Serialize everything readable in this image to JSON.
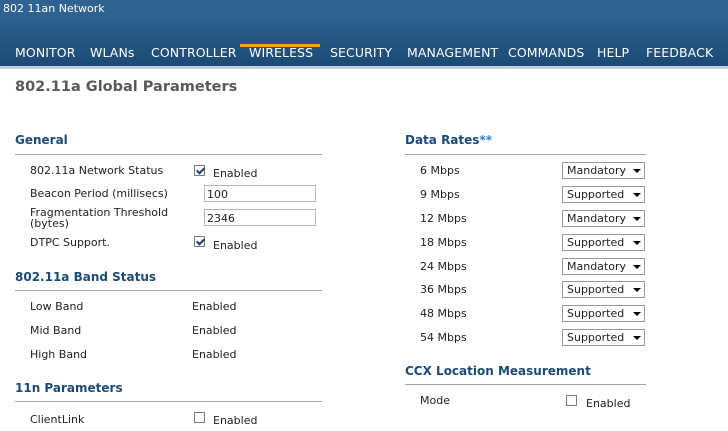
{
  "window_title": "802 11an Network",
  "nav": [
    "MONITOR",
    "WLANs",
    "CONTROLLER",
    "WIRELESS",
    "SECURITY",
    "MANAGEMENT",
    "COMMANDS",
    "HELP",
    "FEEDBACK"
  ],
  "nav_active": "WIRELESS",
  "page_title": "802.11a Global Parameters",
  "general": {
    "title": "General",
    "network_status_label": "802.11a Network Status",
    "network_status_checked": true,
    "network_status_text": "Enabled",
    "beacon_label": "Beacon Period (millisecs)",
    "beacon_value": "100",
    "frag_label": "Fragmentation Threshold (bytes)",
    "frag_value": "2346",
    "dtpc_label": "DTPC Support.",
    "dtpc_checked": true,
    "dtpc_text": "Enabled"
  },
  "band_status": {
    "title": "802.11a Band Status",
    "low_label": "Low Band",
    "low_value": "Enabled",
    "mid_label": "Mid Band",
    "mid_value": "Enabled",
    "high_label": "High Band",
    "high_value": "Enabled"
  },
  "n_params": {
    "title": "11n Parameters",
    "clientlink_label": "ClientLink",
    "clientlink_checked": false,
    "clientlink_text": "Enabled"
  },
  "data_rates": {
    "title": "Data Rates",
    "title_suffix": "**",
    "rows": [
      {
        "rate": "6 Mbps",
        "value": "Mandatory"
      },
      {
        "rate": "9 Mbps",
        "value": "Supported"
      },
      {
        "rate": "12 Mbps",
        "value": "Mandatory"
      },
      {
        "rate": "18 Mbps",
        "value": "Supported"
      },
      {
        "rate": "24 Mbps",
        "value": "Mandatory"
      },
      {
        "rate": "36 Mbps",
        "value": "Supported"
      },
      {
        "rate": "48 Mbps",
        "value": "Supported"
      },
      {
        "rate": "54 Mbps",
        "value": "Supported"
      }
    ]
  },
  "ccx": {
    "title": "CCX Location Measurement",
    "mode_label": "Mode",
    "mode_checked": false,
    "mode_text": "Enabled"
  },
  "colors": {
    "title_bar": "#2e6391",
    "nav_bar": "#1b4a75",
    "nav_active_underline": "#f3a51c",
    "section_title": "#1b4b78",
    "data_rates_asterisk": "#2c7fc2"
  }
}
